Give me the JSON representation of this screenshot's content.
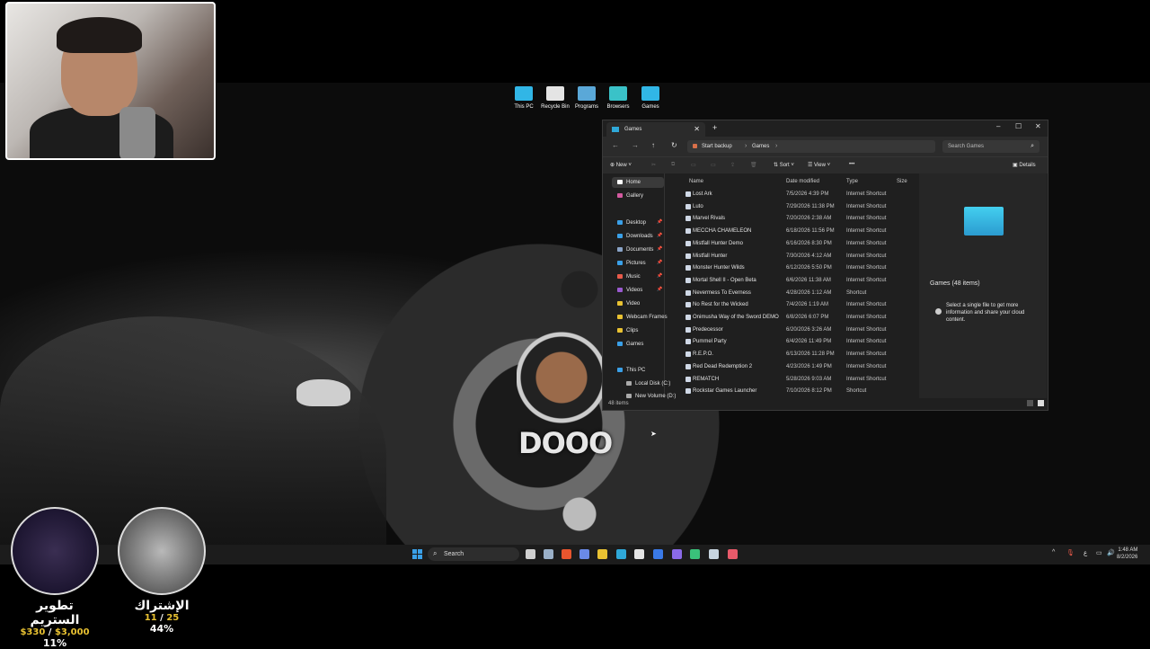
{
  "desktop_icons": [
    {
      "label": "This PC"
    },
    {
      "label": "Recycle Bin"
    },
    {
      "label": "Programs"
    },
    {
      "label": "Browsers"
    },
    {
      "label": "Games"
    }
  ],
  "wallpaper": {
    "logo_text": "DOOO"
  },
  "explorer": {
    "tab_title": "Games",
    "new_tab": "+",
    "window_controls": {
      "minimize": "–",
      "maximize": "☐",
      "close": "✕"
    },
    "breadcrumb": [
      "Start backup",
      "Games"
    ],
    "search_placeholder": "Search Games",
    "toolbar": {
      "new": "New",
      "sort": "Sort",
      "view": "View",
      "more": "•••",
      "details": "Details"
    },
    "sidebar": [
      {
        "label": "Home",
        "color": "#ffffff"
      },
      {
        "label": "Gallery",
        "color": "#d45aa0"
      },
      {
        "label": "Desktop",
        "color": "#3aa0e8",
        "pinned": true
      },
      {
        "label": "Downloads",
        "color": "#3aa0e8",
        "pinned": true
      },
      {
        "label": "Documents",
        "color": "#8aa4c8",
        "pinned": true
      },
      {
        "label": "Pictures",
        "color": "#3aa0e8",
        "pinned": true
      },
      {
        "label": "Music",
        "color": "#e85a4a",
        "pinned": true
      },
      {
        "label": "Videos",
        "color": "#9a5ad0",
        "pinned": true
      },
      {
        "label": "Video",
        "color": "#e9c232"
      },
      {
        "label": "Webcam Frames",
        "color": "#e9c232"
      },
      {
        "label": "Clips",
        "color": "#e9c232"
      },
      {
        "label": "Games",
        "color": "#3aa0e8"
      },
      {
        "label": "This PC",
        "color": "#3aa0e8"
      },
      {
        "label": "Local Disk (C:)",
        "color": "#aaaaaa"
      },
      {
        "label": "New Volume (D:)",
        "color": "#aaaaaa"
      }
    ],
    "columns": {
      "name": "Name",
      "date": "Date modified",
      "type": "Type",
      "size": "Size"
    },
    "files": [
      {
        "name": "Lost Ark",
        "date": "7/5/2026 4:39 PM",
        "type": "Internet Shortcut"
      },
      {
        "name": "Luto",
        "date": "7/29/2026 11:38 PM",
        "type": "Internet Shortcut"
      },
      {
        "name": "Marvel Rivals",
        "date": "7/20/2026 2:38 AM",
        "type": "Internet Shortcut"
      },
      {
        "name": "MECCHA CHAMELEON",
        "date": "6/18/2026 11:56 PM",
        "type": "Internet Shortcut"
      },
      {
        "name": "Mistfall Hunter Demo",
        "date": "6/16/2026 8:30 PM",
        "type": "Internet Shortcut"
      },
      {
        "name": "Mistfall Hunter",
        "date": "7/30/2026 4:12 AM",
        "type": "Internet Shortcut"
      },
      {
        "name": "Monster Hunter Wilds",
        "date": "6/12/2026 5:50 PM",
        "type": "Internet Shortcut"
      },
      {
        "name": "Mortal Shell II - Open Beta",
        "date": "6/6/2026 11:38 AM",
        "type": "Internet Shortcut"
      },
      {
        "name": "Nevermess To Everness",
        "date": "4/28/2026 1:12 AM",
        "type": "Shortcut"
      },
      {
        "name": "No Rest for the Wicked",
        "date": "7/4/2026 1:19 AM",
        "type": "Internet Shortcut"
      },
      {
        "name": "Onimusha Way of the Sword DEMO",
        "date": "6/8/2026 6:07 PM",
        "type": "Internet Shortcut"
      },
      {
        "name": "Predecessor",
        "date": "6/20/2026 3:26 AM",
        "type": "Internet Shortcut"
      },
      {
        "name": "Pummel Party",
        "date": "6/4/2026 11:49 PM",
        "type": "Internet Shortcut"
      },
      {
        "name": "R.E.P.O.",
        "date": "6/13/2026 11:28 PM",
        "type": "Internet Shortcut"
      },
      {
        "name": "Red Dead Redemption 2",
        "date": "4/23/2026 1:49 PM",
        "type": "Internet Shortcut"
      },
      {
        "name": "REMATCH",
        "date": "5/28/2026 9:03 AM",
        "type": "Internet Shortcut"
      },
      {
        "name": "Rockstar Games Launcher",
        "date": "7/10/2026 8:12 PM",
        "type": "Shortcut"
      }
    ],
    "details_pane": {
      "title": "Games (48 items)",
      "message": "Select a single file to get more information and share your cloud content."
    },
    "status": "48 items"
  },
  "taskbar": {
    "search_label": "Search",
    "apps": [
      {
        "name": "task-view-icon",
        "color": "#cfcfcf"
      },
      {
        "name": "settings-icon",
        "color": "#9ab0c8"
      },
      {
        "name": "brave-icon",
        "color": "#e8552e"
      },
      {
        "name": "copilot-icon",
        "color": "#6a8ae8"
      },
      {
        "name": "file-explorer-icon",
        "color": "#e9c232"
      },
      {
        "name": "edge-icon",
        "color": "#2fa8d8"
      },
      {
        "name": "store-icon",
        "color": "#e4e4e4"
      },
      {
        "name": "mail-icon",
        "color": "#3a7ae8"
      },
      {
        "name": "discord-icon",
        "color": "#8a6ae8"
      },
      {
        "name": "app-green-icon",
        "color": "#3ac27a"
      },
      {
        "name": "steam-icon",
        "color": "#c7d5e0"
      },
      {
        "name": "maps-icon",
        "color": "#e85a6a"
      }
    ],
    "tray": {
      "chevron": "^",
      "lang": "ع",
      "time": "1:48 AM",
      "date": "8/2/2026"
    }
  },
  "overlays": [
    {
      "title": "تطوير الستريم",
      "current": "$330",
      "goal": "$3,000",
      "percent": "11%",
      "style": "purple"
    },
    {
      "title": "الإشتراك",
      "current": "11",
      "goal": "25",
      "percent": "44%",
      "style": "grey"
    }
  ]
}
